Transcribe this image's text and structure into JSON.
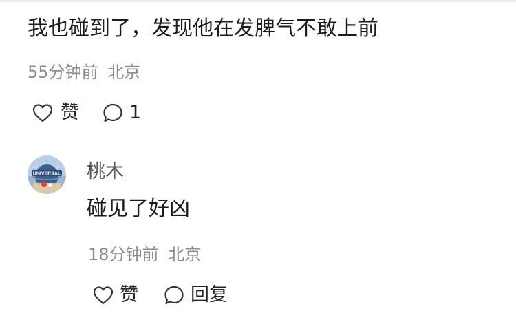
{
  "comment": {
    "text": "我也碰到了，发现他在发脾气不敢上前",
    "time": "55分钟前",
    "location": "北京",
    "like_label": "赞",
    "reply_count": "1",
    "icons": {
      "like": "heart-icon",
      "reply": "speech-bubble-icon"
    }
  },
  "reply": {
    "username": "桃木",
    "avatar_text": "UNIVERSAL",
    "text": "碰见了好凶",
    "time": "18分钟前",
    "location": "北京",
    "like_label": "赞",
    "reply_label": "回复",
    "icons": {
      "like": "heart-icon",
      "reply": "speech-bubble-icon"
    }
  }
}
